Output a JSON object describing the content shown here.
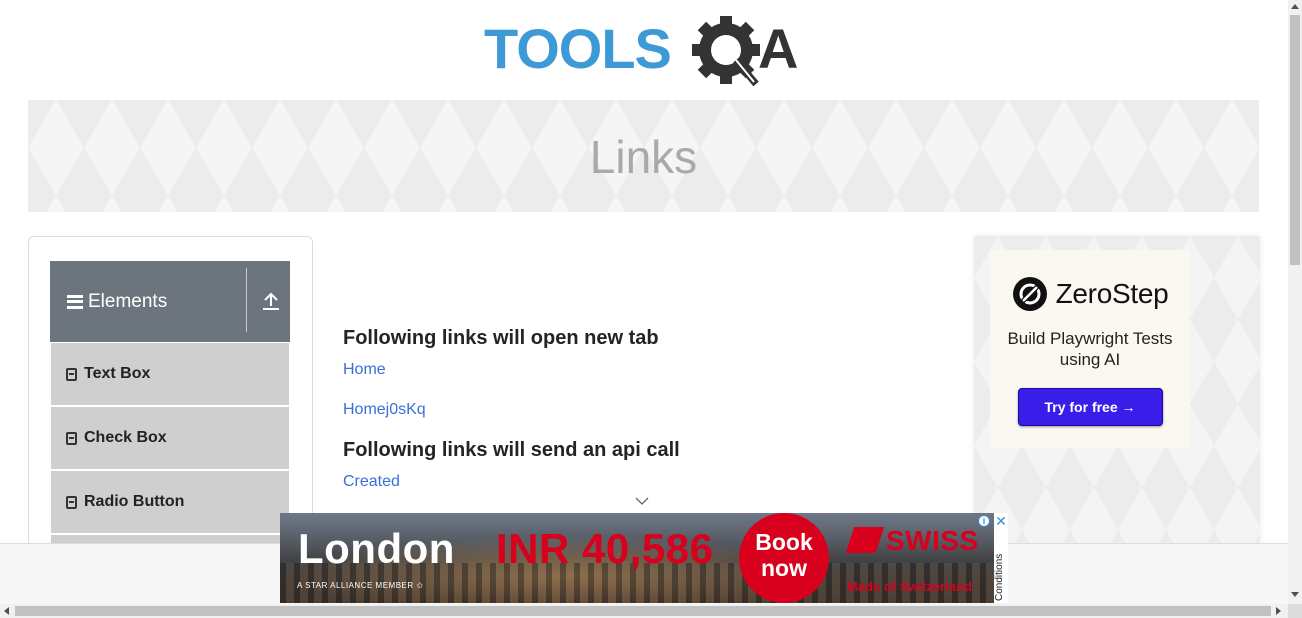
{
  "header": {
    "logo_text": "TOOLSQA",
    "logo_primary": "TOOLS",
    "logo_secondary": "A"
  },
  "banner": {
    "title": "Links"
  },
  "sidebar": {
    "group_title": "Elements",
    "items": [
      {
        "label": "Text Box"
      },
      {
        "label": "Check Box"
      },
      {
        "label": "Radio Button"
      }
    ]
  },
  "main": {
    "heading_new_tab": "Following links will open new tab",
    "links_new_tab": [
      "Home",
      "Homej0sKq"
    ],
    "heading_api": "Following links will send an api call",
    "links_api": [
      "Created"
    ]
  },
  "right_ad": {
    "brand": "ZeroStep",
    "tagline": "Build Playwright Tests using AI",
    "cta": "Try for free →"
  },
  "bottom_ad": {
    "city": "London",
    "price": "INR 40,586",
    "alliance": "A STAR ALLIANCE MEMBER ✩",
    "cta": "Book now",
    "airline": "SWISS",
    "slogan": "Made of Switzerland",
    "conditions": "Conditions",
    "info_symbol": "i",
    "close_symbol": "✕"
  },
  "colors": {
    "logo_blue": "#3d9ad6",
    "logo_dark": "#333333",
    "sidebar_header": "#6c757d",
    "link": "#3b6fd9",
    "cta_purple": "#3a1de8",
    "ad_red": "#d8001c"
  },
  "icons": {
    "logo_gear": "gear-magnifier-icon",
    "menu": "hamburger-icon",
    "collapse": "upload-icon",
    "item": "html5-icon",
    "scroll_hint": "chevron-down-icon"
  }
}
